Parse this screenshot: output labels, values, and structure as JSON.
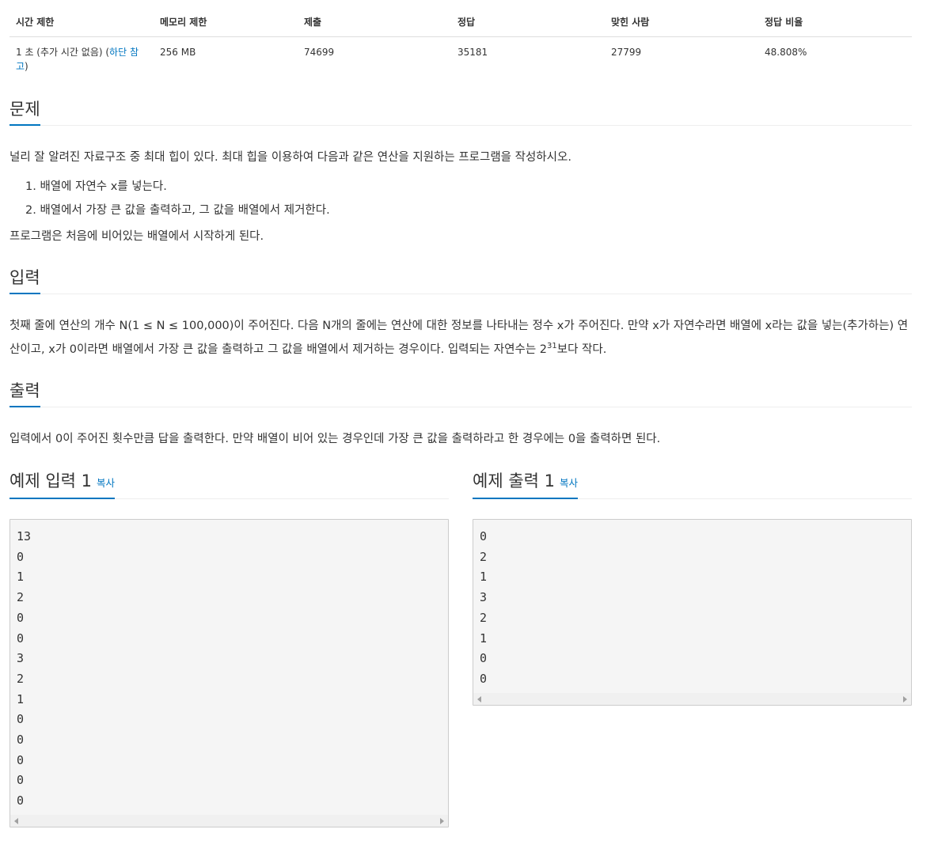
{
  "info_table": {
    "headers": [
      "시간 제한",
      "메모리 제한",
      "제출",
      "정답",
      "맞힌 사람",
      "정답 비율"
    ],
    "time_limit_prefix": "1 초 (추가 시간 없음) (",
    "time_limit_link": "하단 참고",
    "time_limit_suffix": ")",
    "memory_limit": "256 MB",
    "submissions": "74699",
    "accepted": "35181",
    "solved_users": "27799",
    "accept_ratio": "48.808%"
  },
  "problem": {
    "title": "문제",
    "intro": "널리 잘 알려진 자료구조 중 최대 힙이 있다. 최대 힙을 이용하여 다음과 같은 연산을 지원하는 프로그램을 작성하시오.",
    "steps": [
      "1. 배열에 자연수 x를 넣는다.",
      "2. 배열에서 가장 큰 값을 출력하고, 그 값을 배열에서 제거한다."
    ],
    "outro": "프로그램은 처음에 비어있는 배열에서 시작하게 된다."
  },
  "input": {
    "title": "입력",
    "text_before_sup": "첫째 줄에 연산의 개수 N(1 ≤ N ≤ 100,000)이 주어진다. 다음 N개의 줄에는 연산에 대한 정보를 나타내는 정수 x가 주어진다. 만약 x가 자연수라면 배열에 x라는 값을 넣는(추가하는) 연산이고, x가 0이라면 배열에서 가장 큰 값을 출력하고 그 값을 배열에서 제거하는 경우이다. 입력되는 자연수는 2",
    "sup": "31",
    "text_after_sup": "보다 작다."
  },
  "output": {
    "title": "출력",
    "text": "입력에서 0이 주어진 횟수만큼 답을 출력한다. 만약 배열이 비어 있는 경우인데 가장 큰 값을 출력하라고 한 경우에는 0을 출력하면 된다."
  },
  "sample_input": {
    "title": "예제 입력 1",
    "copy_label": "복사",
    "data": "13\n0\n1\n2\n0\n0\n3\n2\n1\n0\n0\n0\n0\n0"
  },
  "sample_output": {
    "title": "예제 출력 1",
    "copy_label": "복사",
    "data": "0\n2\n1\n3\n2\n1\n0\n0"
  },
  "colors": {
    "accent": "#0076c0",
    "text": "#333333",
    "pre_background": "#f5f5f5"
  }
}
